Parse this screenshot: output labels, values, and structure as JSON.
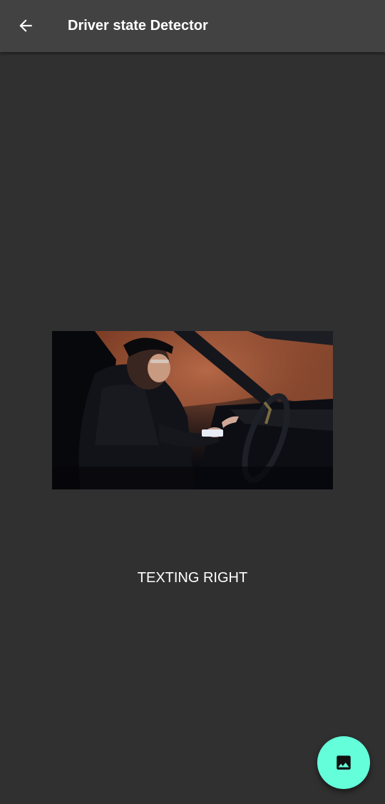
{
  "appbar": {
    "back_icon": "arrow-back-icon",
    "title": "Driver state Detector"
  },
  "photo": {
    "subject": "driver-photo"
  },
  "result": {
    "label": "TEXTING RIGHT"
  },
  "fab": {
    "icon": "image-icon"
  },
  "colors": {
    "background": "#303030",
    "appbar": "#424242",
    "fab": "#64ffda",
    "text": "#ffffff"
  }
}
